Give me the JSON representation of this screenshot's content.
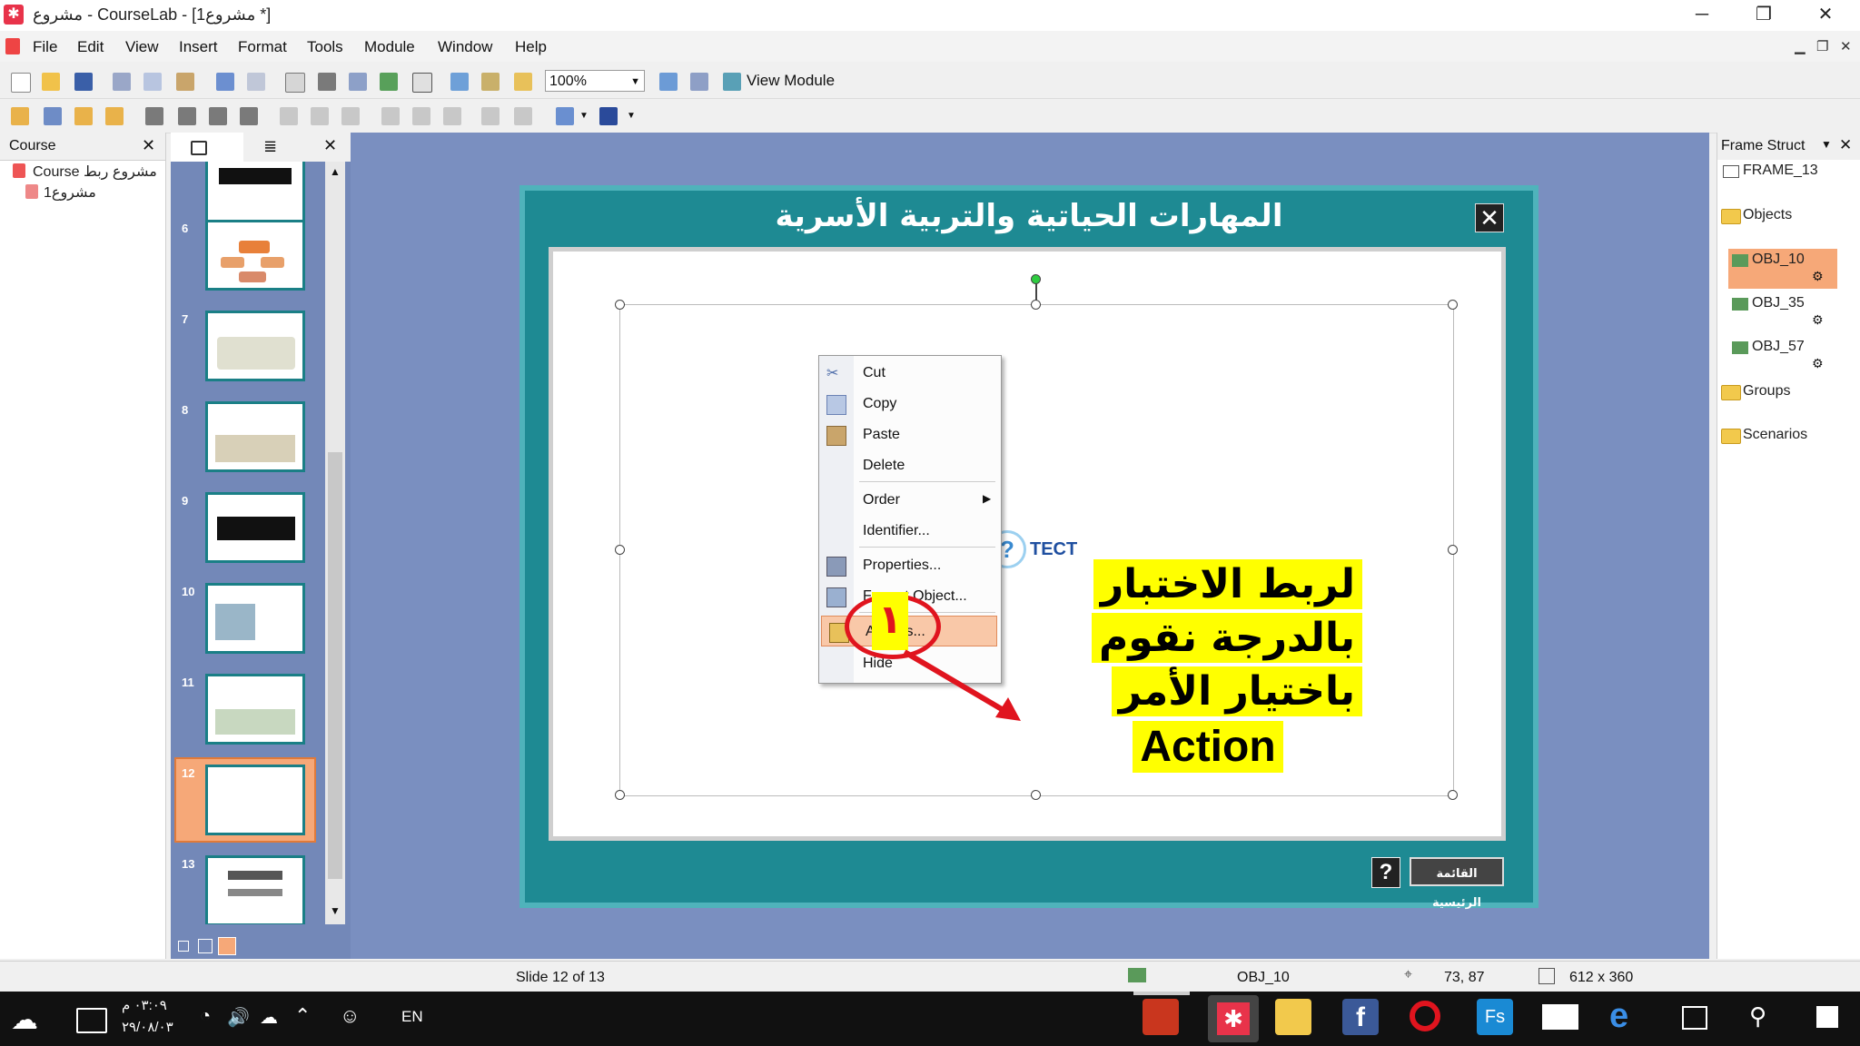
{
  "window": {
    "title": "مشروع - CourseLab - [مشروع1 *]",
    "controls": [
      "─",
      "❐",
      "✕"
    ]
  },
  "menu": [
    "File",
    "Edit",
    "View",
    "Insert",
    "Format",
    "Tools",
    "Module",
    "Window",
    "Help"
  ],
  "toolbar": {
    "zoom_value": "100%",
    "view_module_label": "View Module"
  },
  "course_panel": {
    "header": "Course",
    "tree": [
      "مشروع ربط Course",
      "مشروع1"
    ]
  },
  "slides_panel": {
    "slide_numbers": [
      "6",
      "7",
      "8",
      "9",
      "10",
      "11",
      "12",
      "13"
    ],
    "selected_slide": "12"
  },
  "slide": {
    "title": "المهارات الحياتية والتربية الأسرية",
    "close_glyph": "✕",
    "object_text": "TECT",
    "help_button": "?",
    "main_menu_button": "القائمة الرئيسية"
  },
  "context_menu": {
    "items": [
      "Cut",
      "Copy",
      "Paste",
      "Delete",
      "Order",
      "Identifier...",
      "Properties...",
      "Format Object...",
      "Actions...",
      "Hide"
    ],
    "highlighted_item": "Actions..."
  },
  "annotation": {
    "step_number": "١",
    "lines": [
      "لربط الاختبار",
      "بالدرجة نقوم",
      "باختيار الأمر",
      "Action"
    ]
  },
  "frame_panel": {
    "header": "Frame Struct",
    "frame_name": "FRAME_13",
    "objects_folder": "Objects",
    "objects": [
      "OBJ_10",
      "OBJ_35",
      "OBJ_57"
    ],
    "selected_object": "OBJ_10",
    "groups_folder": "Groups",
    "scenarios_folder": "Scenarios"
  },
  "statusbar": {
    "slide_info": "Slide 12 of 13",
    "object_name": "OBJ_10",
    "position": "73, 87",
    "size": "612 x 360"
  },
  "taskbar": {
    "time": "٠٣:٠٩ م",
    "date": "٢٩/٠٨/٠٣",
    "language": "EN"
  },
  "colors": {
    "slide_bg": "#1e8a93",
    "canvas_bg": "#7a8fc0",
    "highlight": "#f9c8a8",
    "annotation_bg": "#ffff00",
    "annotation_red": "#e0141e"
  }
}
